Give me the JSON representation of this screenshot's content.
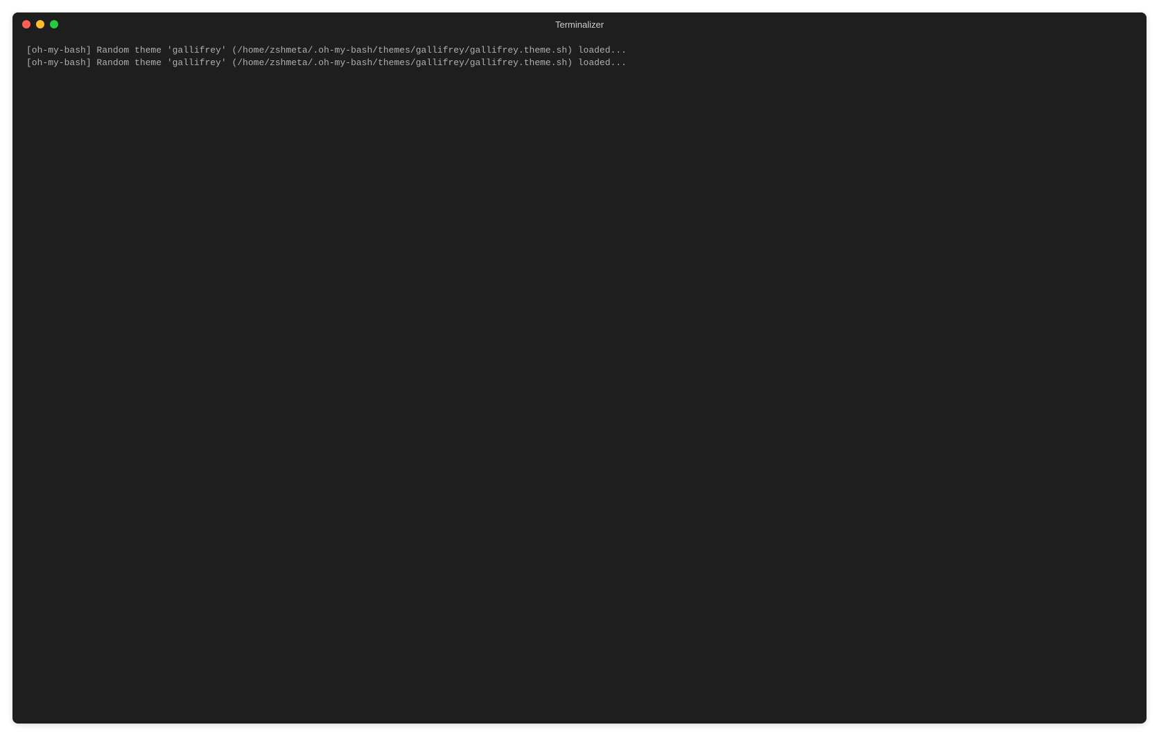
{
  "window": {
    "title": "Terminalizer"
  },
  "terminal": {
    "lines": [
      "[oh-my-bash] Random theme 'gallifrey' (/home/zshmeta/.oh-my-bash/themes/gallifrey/gallifrey.theme.sh) loaded...",
      "[oh-my-bash] Random theme 'gallifrey' (/home/zshmeta/.oh-my-bash/themes/gallifrey/gallifrey.theme.sh) loaded..."
    ]
  },
  "colors": {
    "close": "#ff5f56",
    "minimize": "#ffbd2e",
    "maximize": "#27c93f",
    "background": "#1e1e1e",
    "text": "#b0b0b0"
  }
}
